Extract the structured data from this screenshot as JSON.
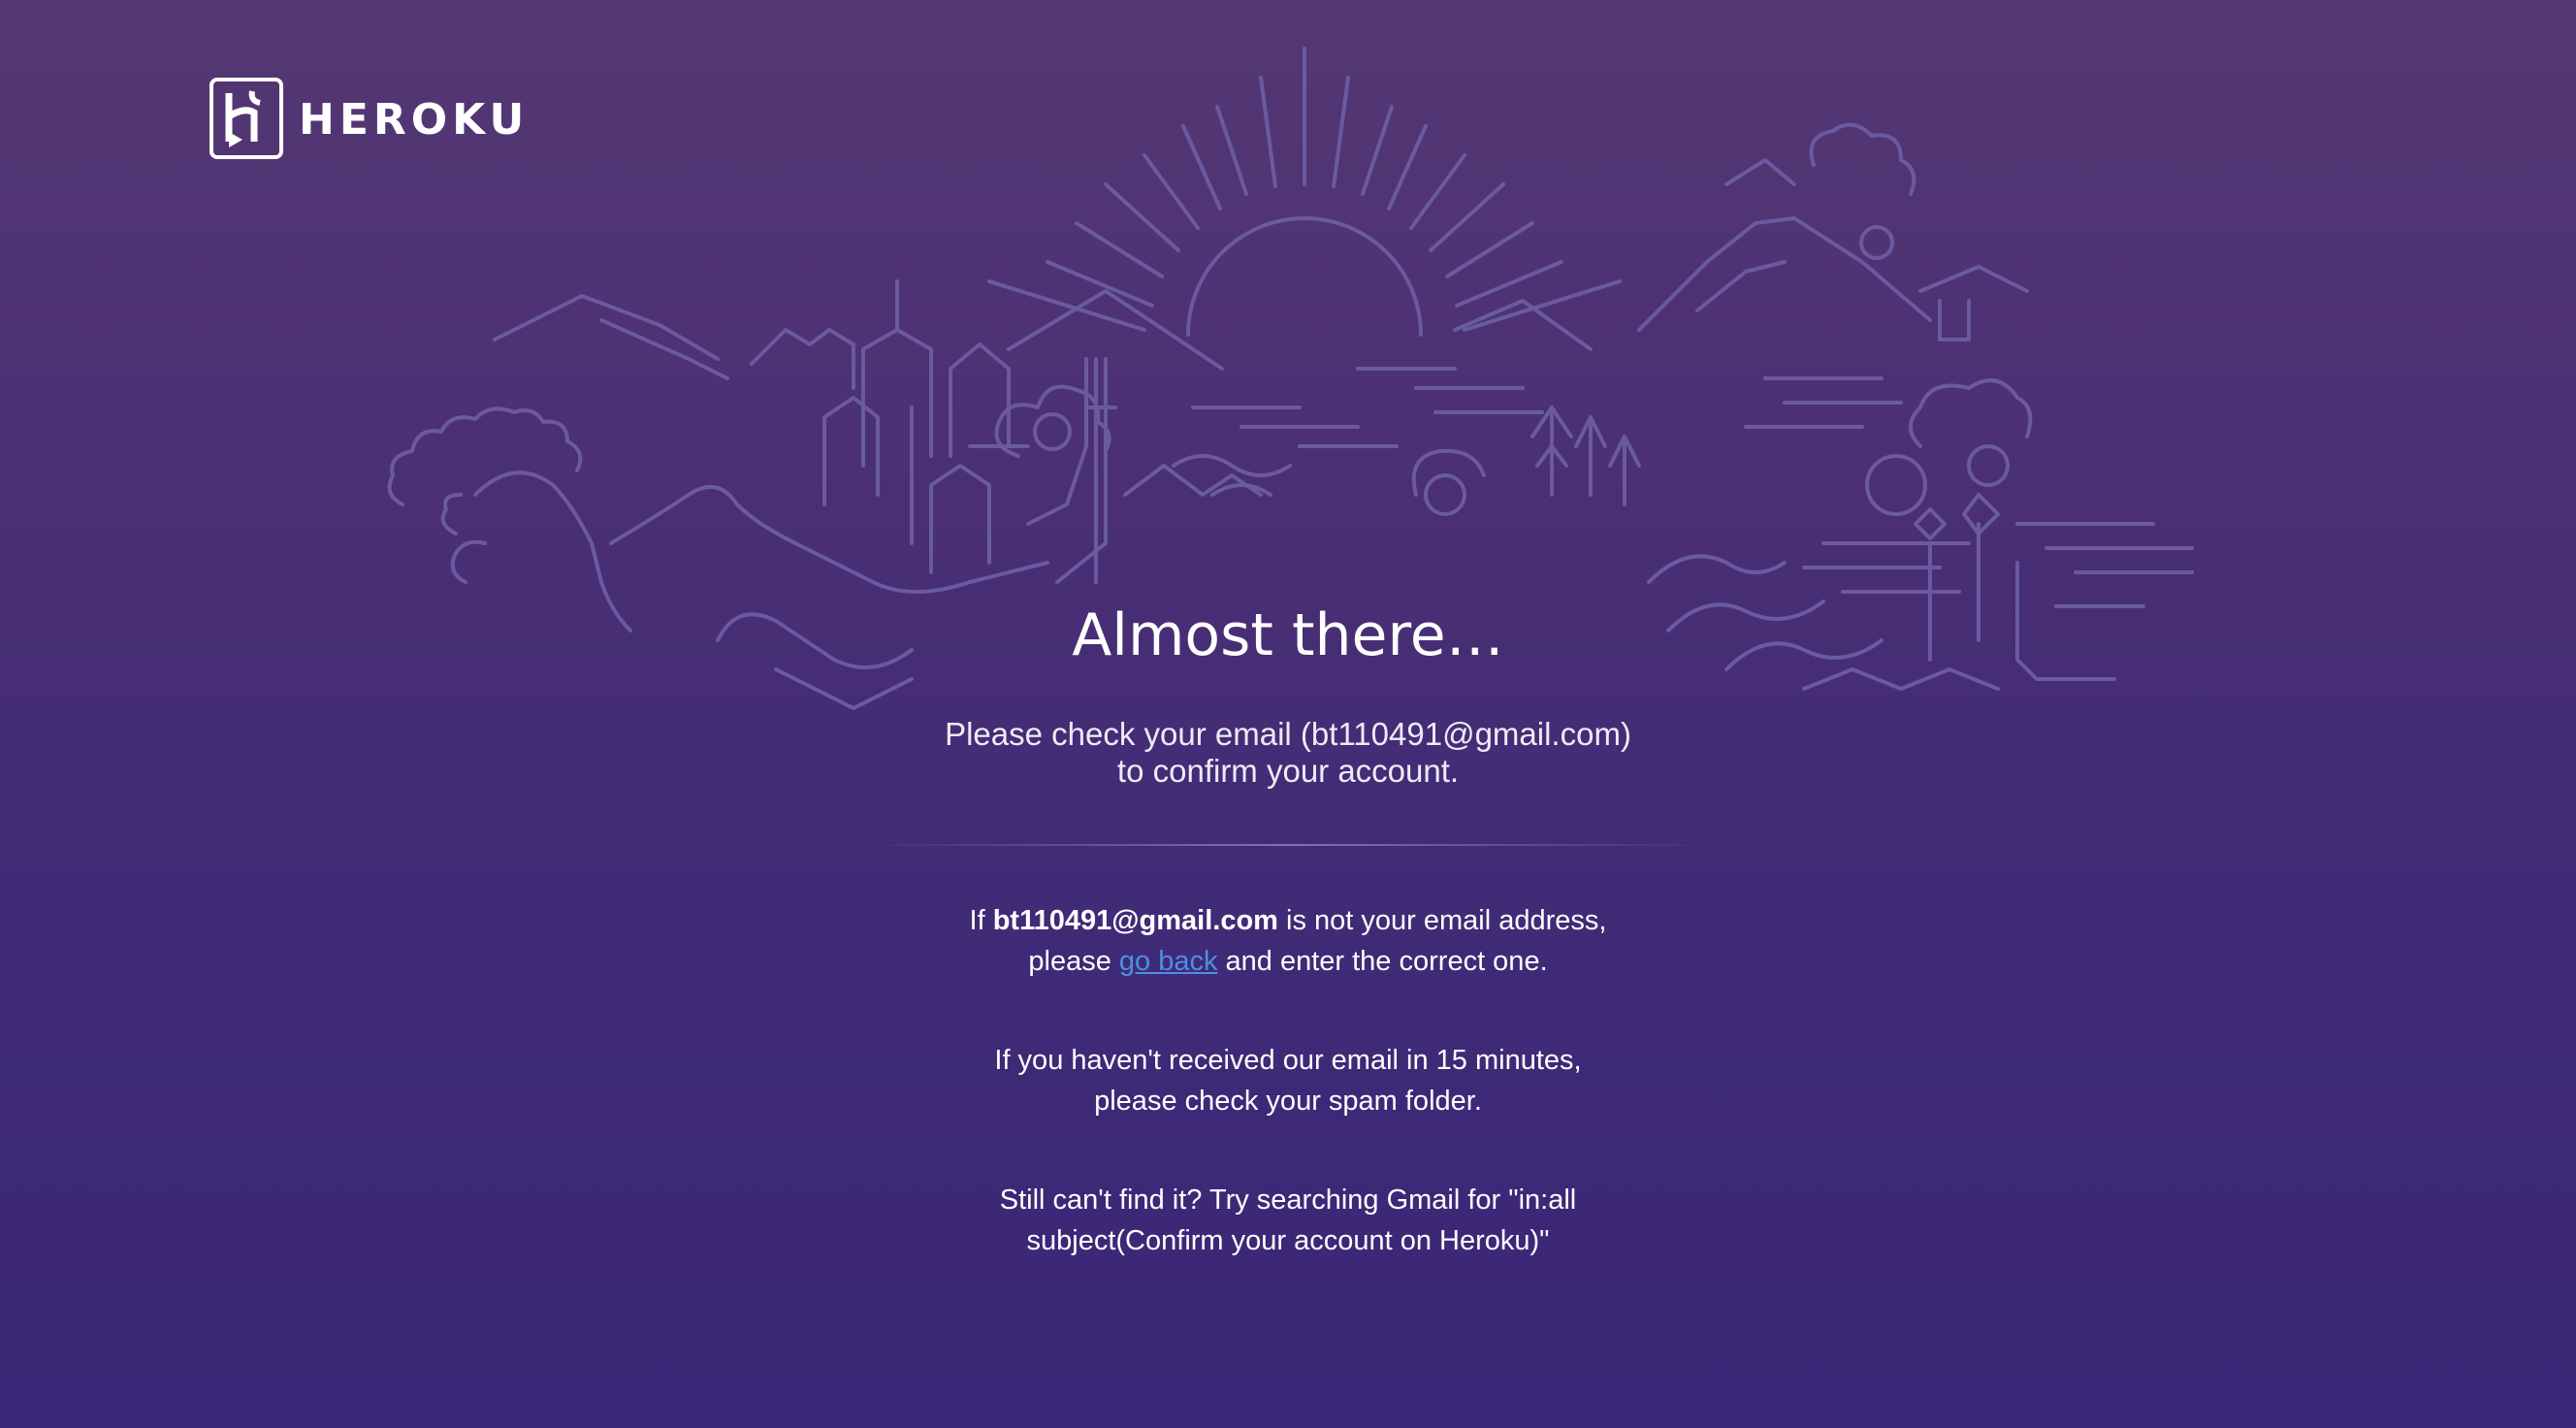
{
  "brand": {
    "name": "HEROKU",
    "logo_icon": "heroku-logo-icon"
  },
  "illustration": {
    "icon": "landscape-illustration",
    "line_color": "#6a5aa0"
  },
  "main": {
    "title": "Almost there…",
    "subtitle_line1": "Please check your email (bt110491@gmail.com)",
    "subtitle_line2": "to confirm your account.",
    "wrong_email": {
      "prefix": "If ",
      "email": "bt110491@gmail.com",
      "suffix": " is not your email address,",
      "line2_prefix": "please ",
      "link_text": "go back",
      "line2_suffix": " and enter the correct one."
    },
    "spam_line1": "If you haven't received our email in 15 minutes,",
    "spam_line2": "please check your spam folder.",
    "search_line1": "Still can't find it? Try searching Gmail for \"in:all",
    "search_line2": "subject(Confirm your account on Heroku)\""
  },
  "colors": {
    "background_top": "#543873",
    "background_bottom": "#3a2777",
    "link": "#4c8fe0"
  }
}
